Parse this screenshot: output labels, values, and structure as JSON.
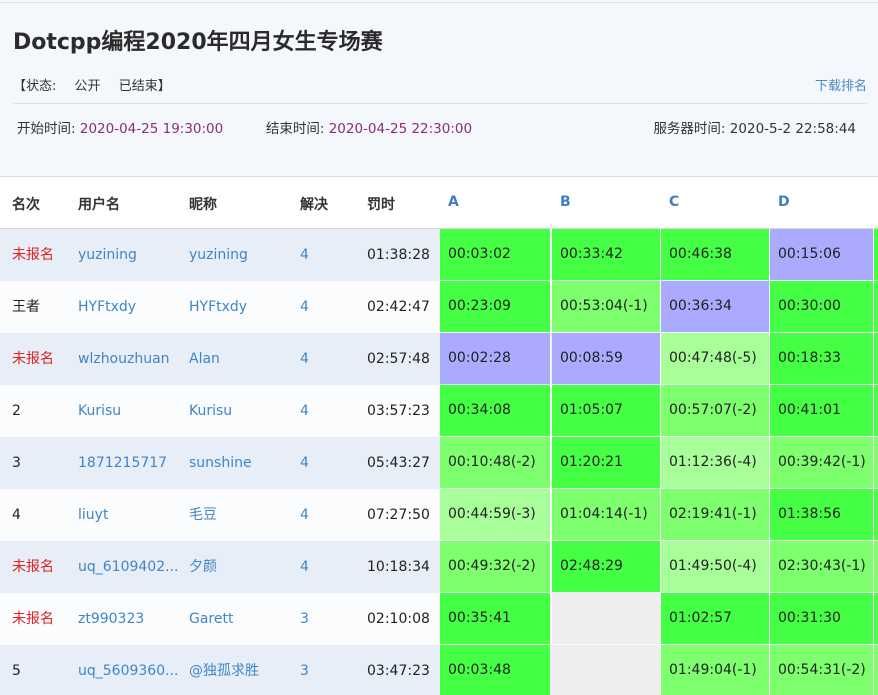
{
  "title": "Dotcpp编程2020年四月女生专场赛",
  "status": {
    "label": "【状态:",
    "visibility": "公开",
    "state": "已结束】"
  },
  "download_label": "下载排名",
  "times": {
    "start_label": "开始时间:",
    "start_value": "2020-04-25 19:30:00",
    "end_label": "结束时间:",
    "end_value": "2020-04-25 22:30:00",
    "server_label": "服务器时间:",
    "server_value": "2020-5-2 22:58:44"
  },
  "columns": [
    "名次",
    "用户名",
    "昵称",
    "解决",
    "罚时",
    "A",
    "B",
    "C",
    "D"
  ],
  "colors": {
    "solved": "#44ff44",
    "solved_mid": "#7dff6e",
    "solved_light": "#a8ff9a",
    "first_blood": "#aaaaff",
    "unsolved": "#eeeeee",
    "red": "#dd2222",
    "link": "#3f86c6"
  },
  "rows": [
    {
      "rank": "未报名",
      "rank_red": true,
      "user": "yuzining",
      "nick": "yuzining",
      "solved": "4",
      "penalty": "01:38:28",
      "problems": [
        {
          "text": "00:03:02",
          "kind": "solved"
        },
        {
          "text": "00:33:42",
          "kind": "solved"
        },
        {
          "text": "00:46:38",
          "kind": "solved"
        },
        {
          "text": "00:15:06",
          "kind": "first_blood"
        }
      ]
    },
    {
      "rank": "王者",
      "rank_red": false,
      "user": "HYFtxdy",
      "nick": "HYFtxdy",
      "solved": "4",
      "penalty": "02:42:47",
      "problems": [
        {
          "text": "00:23:09",
          "kind": "solved"
        },
        {
          "text": "00:53:04(-1)",
          "kind": "solved_mid"
        },
        {
          "text": "00:36:34",
          "kind": "first_blood"
        },
        {
          "text": "00:30:00",
          "kind": "solved"
        }
      ]
    },
    {
      "rank": "未报名",
      "rank_red": true,
      "user": "wlzhouzhuan",
      "nick": "Alan",
      "solved": "4",
      "penalty": "02:57:48",
      "problems": [
        {
          "text": "00:02:28",
          "kind": "first_blood"
        },
        {
          "text": "00:08:59",
          "kind": "first_blood"
        },
        {
          "text": "00:47:48(-5)",
          "kind": "solved_light"
        },
        {
          "text": "00:18:33",
          "kind": "solved"
        }
      ]
    },
    {
      "rank": "2",
      "rank_red": false,
      "user": "Kurisu",
      "nick": "Kurisu",
      "solved": "4",
      "penalty": "03:57:23",
      "problems": [
        {
          "text": "00:34:08",
          "kind": "solved"
        },
        {
          "text": "01:05:07",
          "kind": "solved"
        },
        {
          "text": "00:57:07(-2)",
          "kind": "solved_mid"
        },
        {
          "text": "00:41:01",
          "kind": "solved"
        }
      ]
    },
    {
      "rank": "3",
      "rank_red": false,
      "user": "1871215717",
      "nick": "sunshine",
      "solved": "4",
      "penalty": "05:43:27",
      "problems": [
        {
          "text": "00:10:48(-2)",
          "kind": "solved_mid"
        },
        {
          "text": "01:20:21",
          "kind": "solved"
        },
        {
          "text": "01:12:36(-4)",
          "kind": "solved_light"
        },
        {
          "text": "00:39:42(-1)",
          "kind": "solved_mid"
        }
      ]
    },
    {
      "rank": "4",
      "rank_red": false,
      "user": "liuyt",
      "nick": "毛豆",
      "solved": "4",
      "penalty": "07:27:50",
      "problems": [
        {
          "text": "00:44:59(-3)",
          "kind": "solved_light"
        },
        {
          "text": "01:04:14(-1)",
          "kind": "solved_mid"
        },
        {
          "text": "02:19:41(-1)",
          "kind": "solved_mid"
        },
        {
          "text": "01:38:56",
          "kind": "solved"
        }
      ]
    },
    {
      "rank": "未报名",
      "rank_red": true,
      "user": "uq_6109402...",
      "nick": "夕颜",
      "solved": "4",
      "penalty": "10:18:34",
      "problems": [
        {
          "text": "00:49:32(-2)",
          "kind": "solved_mid"
        },
        {
          "text": "02:48:29",
          "kind": "solved"
        },
        {
          "text": "01:49:50(-4)",
          "kind": "solved_light"
        },
        {
          "text": "02:30:43(-1)",
          "kind": "solved_mid"
        }
      ]
    },
    {
      "rank": "未报名",
      "rank_red": true,
      "user": "zt990323",
      "nick": "Garett",
      "solved": "3",
      "penalty": "02:10:08",
      "problems": [
        {
          "text": "00:35:41",
          "kind": "solved"
        },
        {
          "text": "",
          "kind": "unsolved"
        },
        {
          "text": "01:02:57",
          "kind": "solved"
        },
        {
          "text": "00:31:30",
          "kind": "solved"
        }
      ]
    },
    {
      "rank": "5",
      "rank_red": false,
      "user": "uq_5609360...",
      "nick": "@独孤求胜",
      "solved": "3",
      "penalty": "03:47:23",
      "problems": [
        {
          "text": "00:03:48",
          "kind": "solved"
        },
        {
          "text": "",
          "kind": "unsolved"
        },
        {
          "text": "01:49:04(-1)",
          "kind": "solved_mid"
        },
        {
          "text": "00:54:31(-2)",
          "kind": "solved_mid"
        }
      ]
    }
  ]
}
